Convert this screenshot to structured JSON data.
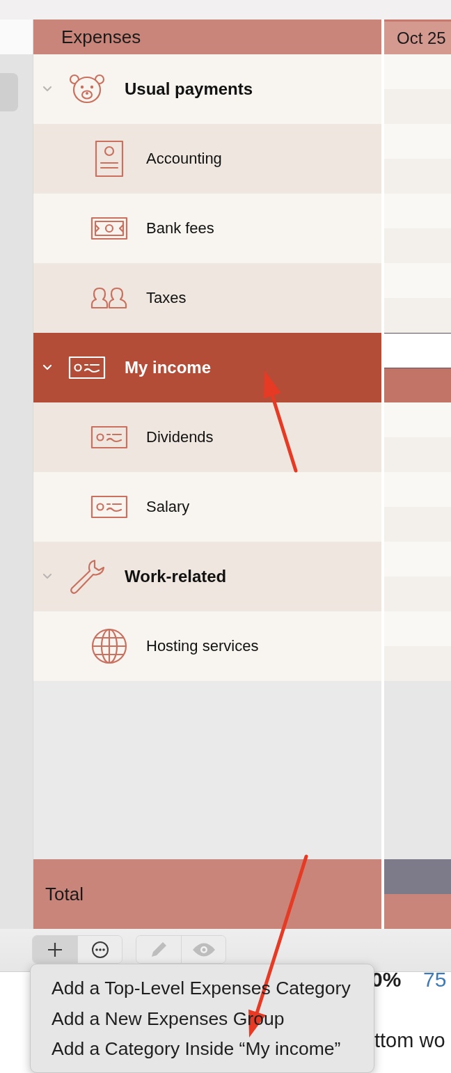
{
  "table": {
    "header": "Expenses",
    "column_2": "Oct 25",
    "groups": [
      {
        "label": "Usual payments",
        "kind": "bear",
        "expanded": true,
        "selected": false,
        "children": [
          {
            "label": "Accounting",
            "kind": "invoice",
            "selected": false
          },
          {
            "label": "Bank fees",
            "kind": "banknote",
            "selected": false
          },
          {
            "label": "Taxes",
            "kind": "people",
            "selected": false
          }
        ]
      },
      {
        "label": "My income",
        "kind": "cheque",
        "expanded": true,
        "selected": true,
        "children": [
          {
            "label": "Dividends",
            "kind": "cheque",
            "selected": false
          },
          {
            "label": "Salary",
            "kind": "cheque",
            "selected": false
          }
        ]
      },
      {
        "label": "Work-related",
        "kind": "wrench",
        "expanded": true,
        "selected": false,
        "children": [
          {
            "label": "Hosting services",
            "kind": "globe",
            "selected": false
          }
        ]
      }
    ],
    "total": "Total"
  },
  "toolbar": {
    "buttons": [
      {
        "kind": "add",
        "selected": true,
        "disabled": false
      },
      {
        "kind": "more",
        "selected": false,
        "disabled": false
      },
      {
        "kind": "edit",
        "selected": false,
        "disabled": true
      },
      {
        "kind": "view",
        "selected": false,
        "disabled": true
      }
    ]
  },
  "background_text": [
    "0%",
    "75",
    "ttom wo"
  ],
  "menu": {
    "items": [
      "Add a Top-Level Expenses Category",
      "Add a New Expenses Group",
      "Add a Category Inside “My income”"
    ]
  },
  "annotations": [
    {
      "kind": "arrow"
    },
    {
      "kind": "arrow"
    }
  ]
}
